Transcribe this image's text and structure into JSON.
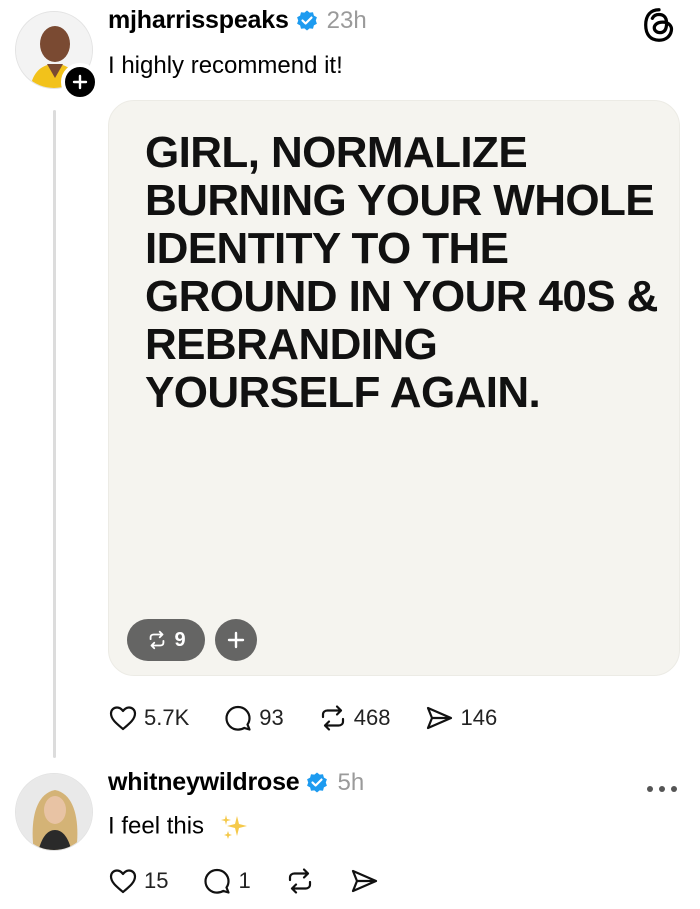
{
  "post": {
    "author": {
      "username": "mjharrisspeaks",
      "verified": true,
      "time": "23h"
    },
    "caption": "I highly recommend it!",
    "image_text": "GIRL, NORMALIZE BURNING YOUR WHOLE IDENTITY TO THE GROUND IN YOUR 40S & REBRANDING YOURSELF AGAIN.",
    "media_repost_count": "9",
    "stats": {
      "likes": "5.7K",
      "replies": "93",
      "reposts": "468",
      "shares": "146"
    }
  },
  "reply": {
    "author": {
      "username": "whitneywildrose",
      "verified": true,
      "time": "5h"
    },
    "text": "I feel this",
    "stats": {
      "likes": "15",
      "replies": "1"
    }
  },
  "colors": {
    "verified": "#1d9bf0",
    "card_bg": "#f5f4ef",
    "muted": "#9a9a9a",
    "sparkle": "#f5c94a"
  },
  "icons": [
    "threads-logo-icon",
    "verified-icon",
    "follow-plus-icon",
    "heart-icon",
    "comment-icon",
    "repost-icon",
    "share-icon",
    "more-icon",
    "sparkle-icon"
  ]
}
